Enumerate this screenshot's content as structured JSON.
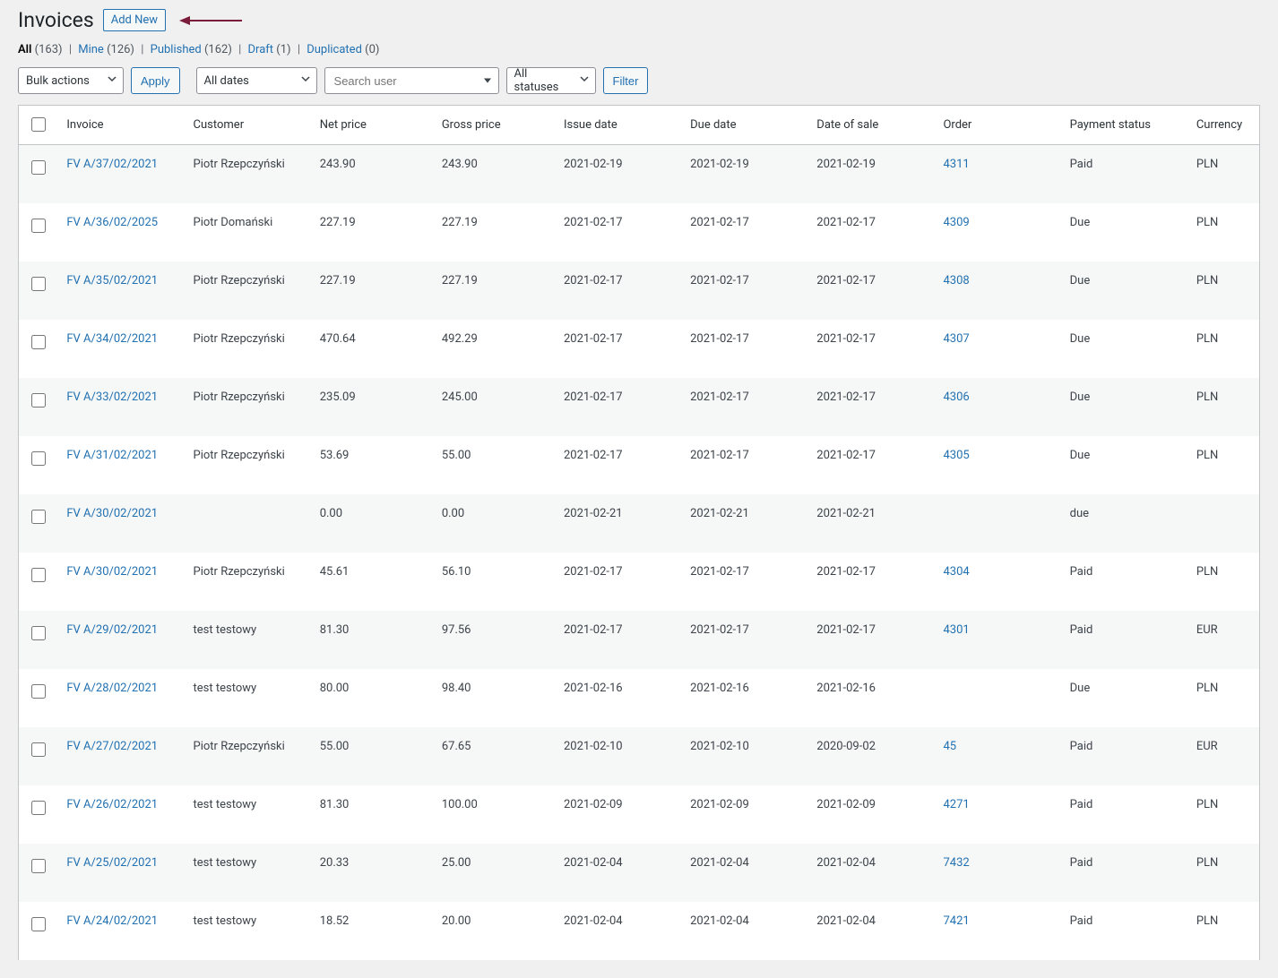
{
  "header": {
    "title": "Invoices",
    "add_new": "Add New"
  },
  "filters": {
    "all_label": "All",
    "all_count": "(163)",
    "mine_label": "Mine",
    "mine_count": "(126)",
    "published_label": "Published",
    "published_count": "(162)",
    "draft_label": "Draft",
    "draft_count": "(1)",
    "duplicated_label": "Duplicated",
    "duplicated_count": "(0)"
  },
  "toolbar": {
    "bulk_actions": "Bulk actions",
    "apply": "Apply",
    "all_dates": "All dates",
    "search_placeholder": "Search user",
    "all_statuses": "All statuses",
    "filter": "Filter"
  },
  "columns": {
    "invoice": "Invoice",
    "customer": "Customer",
    "net": "Net price",
    "gross": "Gross price",
    "issue": "Issue date",
    "due": "Due date",
    "sale": "Date of sale",
    "order": "Order",
    "status": "Payment status",
    "currency": "Currency"
  },
  "rows": [
    {
      "invoice": "FV A/37/02/2021",
      "customer": "Piotr Rzepczyński",
      "net": "243.90",
      "gross": "243.90",
      "issue": "2021-02-19",
      "due": "2021-02-19",
      "sale": "2021-02-19",
      "order": "4311",
      "status": "Paid",
      "currency": "PLN"
    },
    {
      "invoice": "FV A/36/02/2025",
      "customer": "Piotr Domański",
      "net": "227.19",
      "gross": "227.19",
      "issue": "2021-02-17",
      "due": "2021-02-17",
      "sale": "2021-02-17",
      "order": "4309",
      "status": "Due",
      "currency": "PLN"
    },
    {
      "invoice": "FV A/35/02/2021",
      "customer": "Piotr Rzepczyński",
      "net": "227.19",
      "gross": "227.19",
      "issue": "2021-02-17",
      "due": "2021-02-17",
      "sale": "2021-02-17",
      "order": "4308",
      "status": "Due",
      "currency": "PLN"
    },
    {
      "invoice": "FV A/34/02/2021",
      "customer": "Piotr Rzepczyński",
      "net": "470.64",
      "gross": "492.29",
      "issue": "2021-02-17",
      "due": "2021-02-17",
      "sale": "2021-02-17",
      "order": "4307",
      "status": "Due",
      "currency": "PLN"
    },
    {
      "invoice": "FV A/33/02/2021",
      "customer": "Piotr Rzepczyński",
      "net": "235.09",
      "gross": "245.00",
      "issue": "2021-02-17",
      "due": "2021-02-17",
      "sale": "2021-02-17",
      "order": "4306",
      "status": "Due",
      "currency": "PLN"
    },
    {
      "invoice": "FV A/31/02/2021",
      "customer": "Piotr Rzepczyński",
      "net": "53.69",
      "gross": "55.00",
      "issue": "2021-02-17",
      "due": "2021-02-17",
      "sale": "2021-02-17",
      "order": "4305",
      "status": "Due",
      "currency": "PLN"
    },
    {
      "invoice": "FV A/30/02/2021",
      "customer": "",
      "net": "0.00",
      "gross": "0.00",
      "issue": "2021-02-21",
      "due": "2021-02-21",
      "sale": "2021-02-21",
      "order": "",
      "status": "due",
      "currency": ""
    },
    {
      "invoice": "FV A/30/02/2021",
      "customer": "Piotr Rzepczyński",
      "net": "45.61",
      "gross": "56.10",
      "issue": "2021-02-17",
      "due": "2021-02-17",
      "sale": "2021-02-17",
      "order": "4304",
      "status": "Paid",
      "currency": "PLN"
    },
    {
      "invoice": "FV A/29/02/2021",
      "customer": "test testowy",
      "net": "81.30",
      "gross": "97.56",
      "issue": "2021-02-17",
      "due": "2021-02-17",
      "sale": "2021-02-17",
      "order": "4301",
      "status": "Paid",
      "currency": "EUR"
    },
    {
      "invoice": "FV A/28/02/2021",
      "customer": "test testowy",
      "net": "80.00",
      "gross": "98.40",
      "issue": "2021-02-16",
      "due": "2021-02-16",
      "sale": "2021-02-16",
      "order": "",
      "status": "Due",
      "currency": "PLN"
    },
    {
      "invoice": "FV A/27/02/2021",
      "customer": "Piotr Rzepczyński",
      "net": "55.00",
      "gross": "67.65",
      "issue": "2021-02-10",
      "due": "2021-02-10",
      "sale": "2020-09-02",
      "order": "45",
      "status": "Paid",
      "currency": "EUR"
    },
    {
      "invoice": "FV A/26/02/2021",
      "customer": "test testowy",
      "net": "81.30",
      "gross": "100.00",
      "issue": "2021-02-09",
      "due": "2021-02-09",
      "sale": "2021-02-09",
      "order": "4271",
      "status": "Paid",
      "currency": "PLN"
    },
    {
      "invoice": "FV A/25/02/2021",
      "customer": "test testowy",
      "net": "20.33",
      "gross": "25.00",
      "issue": "2021-02-04",
      "due": "2021-02-04",
      "sale": "2021-02-04",
      "order": "7432",
      "status": "Paid",
      "currency": "PLN"
    },
    {
      "invoice": "FV A/24/02/2021",
      "customer": "test testowy",
      "net": "18.52",
      "gross": "20.00",
      "issue": "2021-02-04",
      "due": "2021-02-04",
      "sale": "2021-02-04",
      "order": "7421",
      "status": "Paid",
      "currency": "PLN"
    }
  ]
}
